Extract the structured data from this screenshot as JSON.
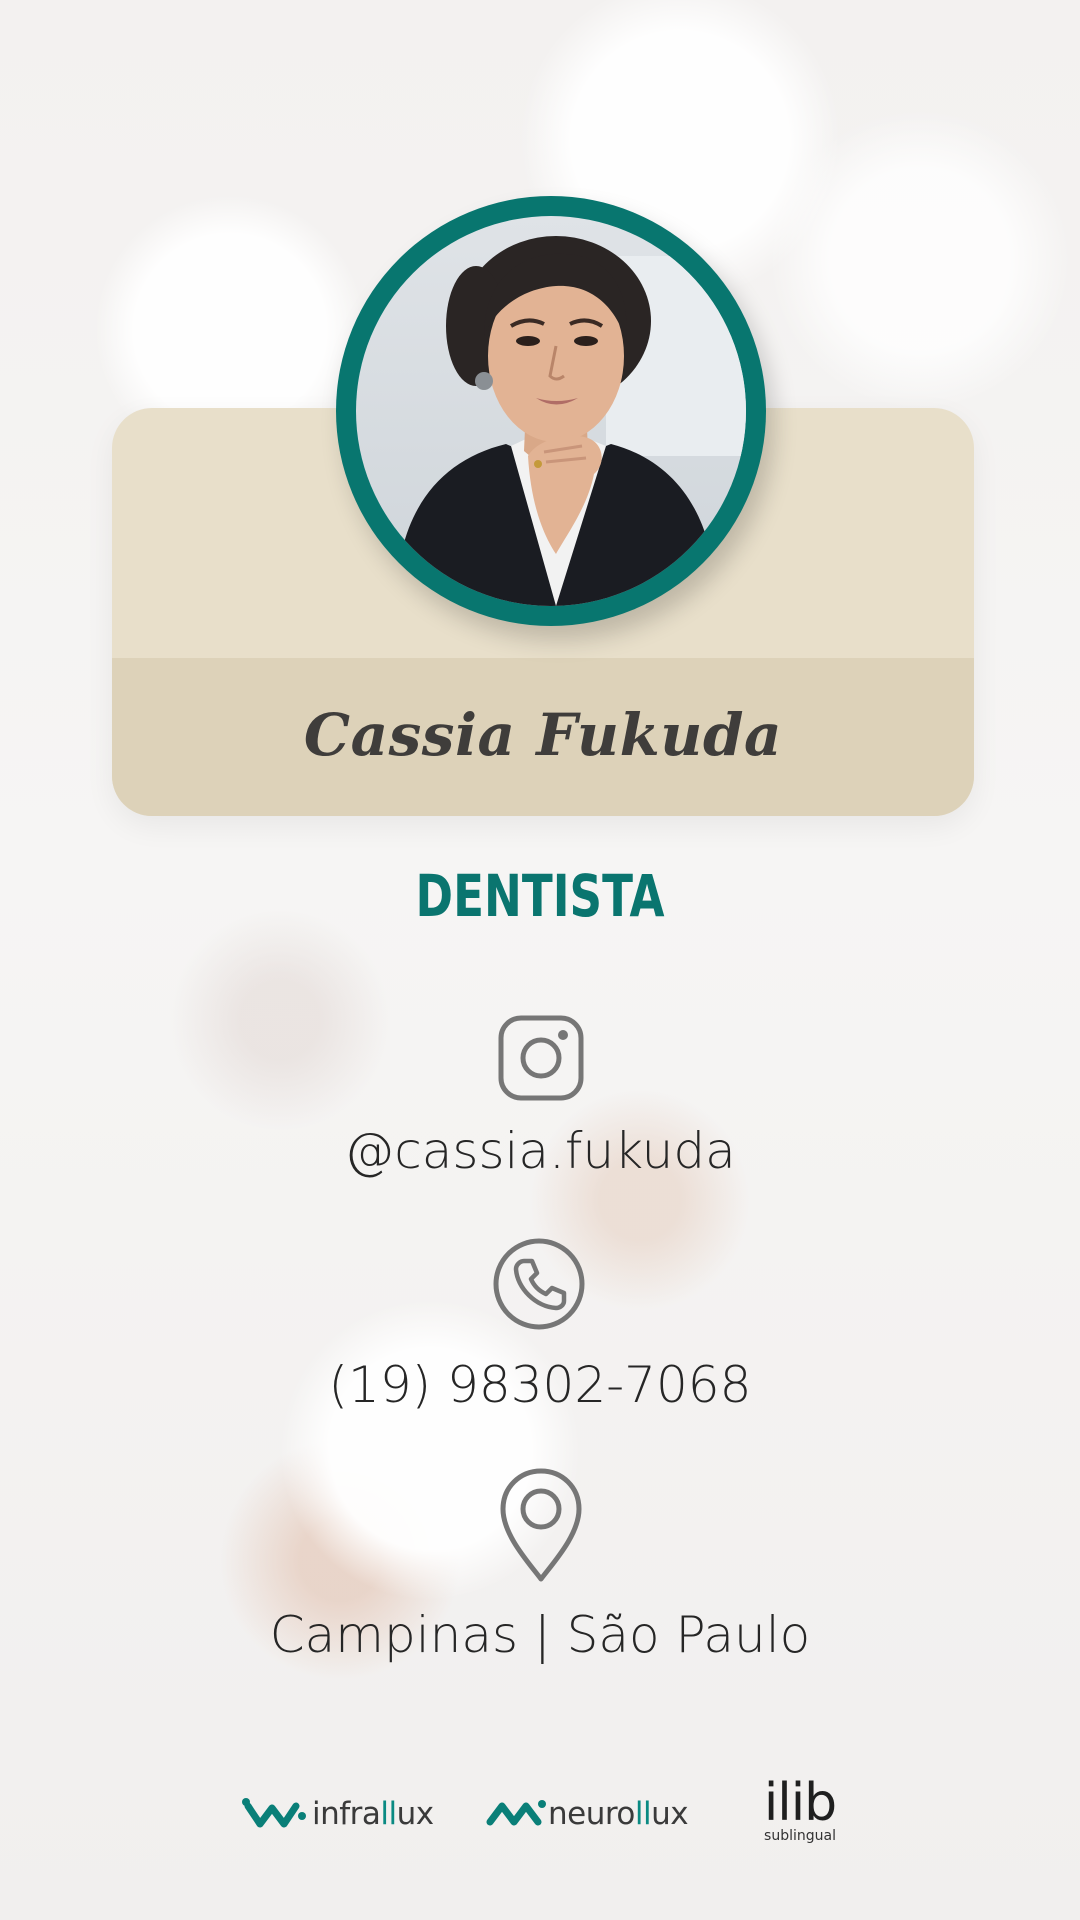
{
  "profile": {
    "name": "Cassia Fukuda",
    "profession": "DENTISTA",
    "photo_alt": "Cassia Fukuda"
  },
  "contacts": {
    "instagram": {
      "icon": "instagram-icon",
      "text": "@cassia.fukuda"
    },
    "phone": {
      "icon": "phone-icon",
      "text": "(19) 98302-7068"
    },
    "location": {
      "icon": "location-pin-icon",
      "text": "Campinas | São Paulo"
    }
  },
  "sponsors": {
    "infralux": {
      "prefix": "infra",
      "highlight": "ll",
      "suffix": "ux"
    },
    "neurolux": {
      "prefix": "neuro",
      "highlight": "ll",
      "suffix": "ux"
    },
    "ilib": {
      "main": "ilib",
      "sub": "sublingual"
    }
  },
  "colors": {
    "accent": "#0a756f",
    "card_top": "#e8dfca",
    "card_bottom": "#ddd2b9",
    "text": "#262626"
  }
}
